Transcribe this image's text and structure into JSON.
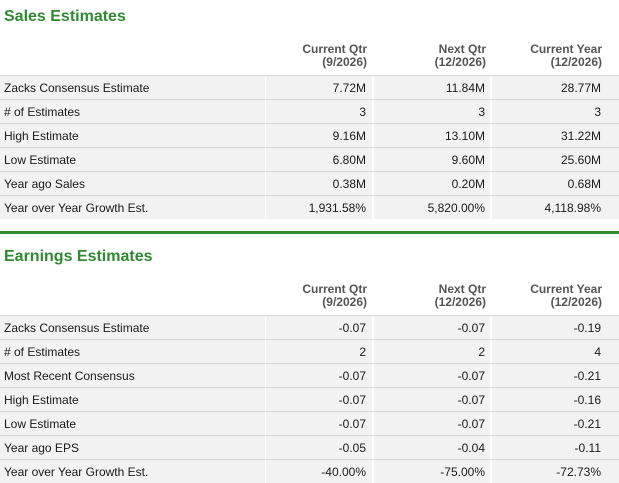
{
  "sales": {
    "title": "Sales Estimates",
    "headers": [
      {
        "line1": "Current Qtr",
        "line2": "(9/2026)"
      },
      {
        "line1": "Next Qtr",
        "line2": "(12/2026)"
      },
      {
        "line1": "Current Year",
        "line2": "(12/2026)"
      }
    ],
    "rows": [
      {
        "label": "Zacks Consensus Estimate",
        "values": [
          "7.72M",
          "11.84M",
          "28.77M"
        ]
      },
      {
        "label": "# of Estimates",
        "values": [
          "3",
          "3",
          "3"
        ]
      },
      {
        "label": "High Estimate",
        "values": [
          "9.16M",
          "13.10M",
          "31.22M"
        ]
      },
      {
        "label": "Low Estimate",
        "values": [
          "6.80M",
          "9.60M",
          "25.60M"
        ]
      },
      {
        "label": "Year ago Sales",
        "values": [
          "0.38M",
          "0.20M",
          "0.68M"
        ]
      },
      {
        "label": "Year over Year Growth Est.",
        "values": [
          "1,931.58%",
          "5,820.00%",
          "4,118.98%"
        ]
      }
    ]
  },
  "earnings": {
    "title": "Earnings Estimates",
    "headers": [
      {
        "line1": "Current Qtr",
        "line2": "(9/2026)"
      },
      {
        "line1": "Next Qtr",
        "line2": "(12/2026)"
      },
      {
        "line1": "Current Year",
        "line2": "(12/2026)"
      }
    ],
    "rows": [
      {
        "label": "Zacks Consensus Estimate",
        "values": [
          "-0.07",
          "-0.07",
          "-0.19"
        ]
      },
      {
        "label": "# of Estimates",
        "values": [
          "2",
          "2",
          "4"
        ]
      },
      {
        "label": "Most Recent Consensus",
        "values": [
          "-0.07",
          "-0.07",
          "-0.21"
        ]
      },
      {
        "label": "High Estimate",
        "values": [
          "-0.07",
          "-0.07",
          "-0.16"
        ]
      },
      {
        "label": "Low Estimate",
        "values": [
          "-0.07",
          "-0.07",
          "-0.21"
        ]
      },
      {
        "label": "Year ago EPS",
        "values": [
          "-0.05",
          "-0.04",
          "-0.11"
        ]
      },
      {
        "label": "Year over Year Growth Est.",
        "values": [
          "-40.00%",
          "-75.00%",
          "-72.73%"
        ]
      }
    ]
  },
  "colors": {
    "accent_green": "#2f8a32",
    "header_text": "#555555",
    "cell_background": "#f2f2f2",
    "row_border": "#d7d7d7"
  }
}
